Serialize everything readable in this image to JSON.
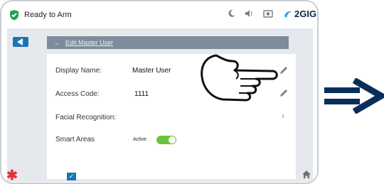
{
  "status": {
    "text": "Ready to Arm",
    "brand": "2GIG"
  },
  "header": {
    "title": "Edit Master User"
  },
  "fields": [
    {
      "label": "Display Name:",
      "value": "Master User"
    },
    {
      "label": "Access Code:",
      "value": "1111"
    },
    {
      "label": "Facial Recognition:",
      "status": "Active",
      "enabled": true
    }
  ],
  "smart_areas": {
    "label": "Smart Areas",
    "checked": true,
    "check_mark": "✓"
  },
  "colors": {
    "accent": "#1a74b5",
    "toggle_on": "#6bc43d",
    "alert": "#e3303a",
    "brand": "#0b2a4a"
  },
  "icons": [
    "shield-check-icon",
    "moon-icon",
    "volume-icon",
    "camera-icon",
    "back-arrow-icon",
    "pencil-icon",
    "chevron-right-icon",
    "home-icon",
    "asterisk-icon",
    "pointing-hand-icon",
    "double-arrow-icon"
  ]
}
